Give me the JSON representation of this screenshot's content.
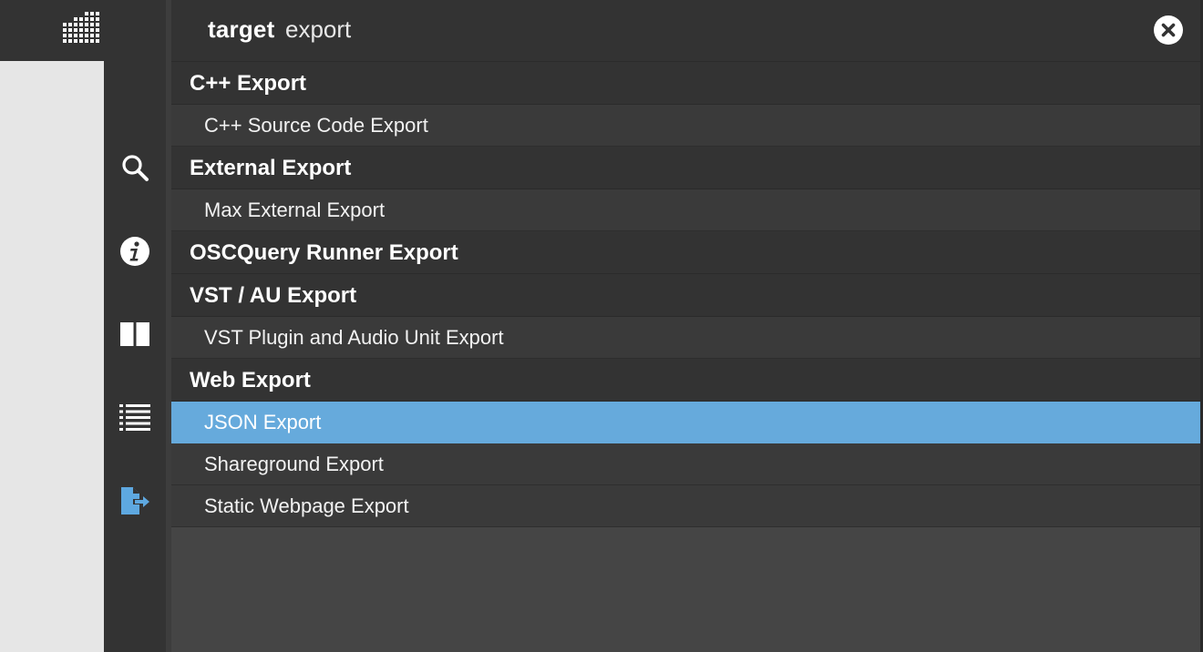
{
  "search": {
    "label": "target",
    "query": "export"
  },
  "sidebar": {
    "icons": [
      "search-icon",
      "info-icon",
      "columns-icon",
      "list-icon",
      "export-icon"
    ],
    "active": "export-icon",
    "active_color": "#5ea8e0"
  },
  "results": {
    "groups": [
      {
        "title": "C++ Export",
        "items": [
          "C++ Source Code Export"
        ]
      },
      {
        "title": "External Export",
        "items": [
          "Max External Export"
        ]
      },
      {
        "title": "OSCQuery Runner Export",
        "items": []
      },
      {
        "title": "VST / AU Export",
        "items": [
          "VST Plugin and Audio Unit Export"
        ]
      },
      {
        "title": "Web Export",
        "items": [
          "JSON Export",
          "Shareground Export",
          "Static Webpage Export"
        ]
      }
    ],
    "selected": "JSON Export",
    "selected_color": "#66aadc"
  }
}
